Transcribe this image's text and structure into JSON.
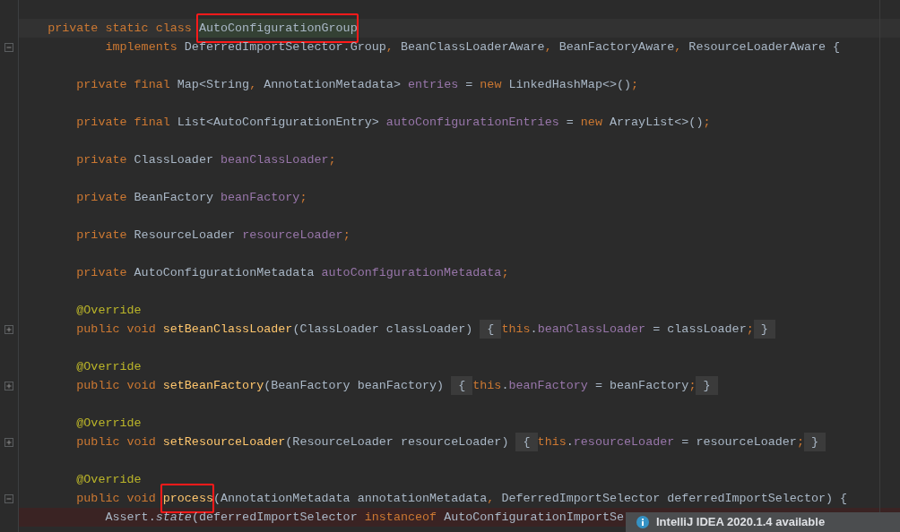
{
  "editor": {
    "lines": [
      {
        "blank_line_before": true,
        "current": true,
        "tokens": [
          {
            "text": "    private static class ",
            "kind": "keyword"
          },
          {
            "text": "AutoConfigurationGroup",
            "kind": "highlight",
            "boxed": true
          }
        ]
      },
      {
        "collapsed": false,
        "tokens": [
          {
            "text": "            implements ",
            "kind": "keyword"
          },
          {
            "text": "DeferredImportSelector.Group",
            "kind": "plain"
          },
          {
            "text": ", ",
            "kind": "keyword"
          },
          {
            "text": "BeanClassLoaderAware",
            "kind": "plain"
          },
          {
            "text": ", ",
            "kind": "keyword"
          },
          {
            "text": "BeanFactoryAware",
            "kind": "plain"
          },
          {
            "text": ", ",
            "kind": "keyword"
          },
          {
            "text": "ResourceLoaderAware {",
            "kind": "plain"
          }
        ]
      },
      {
        "blank_line_before": true,
        "tokens": [
          {
            "text": "        private final ",
            "kind": "keyword"
          },
          {
            "text": "Map<String",
            "kind": "plain"
          },
          {
            "text": ", ",
            "kind": "keyword"
          },
          {
            "text": "AnnotationMetadata> ",
            "kind": "plain"
          },
          {
            "text": "entries",
            "kind": "field"
          },
          {
            "text": " = ",
            "kind": "plain"
          },
          {
            "text": "new ",
            "kind": "keyword"
          },
          {
            "text": "LinkedHashMap<>()",
            "kind": "plain"
          },
          {
            "text": ";",
            "kind": "keyword"
          }
        ]
      },
      {
        "blank_line_before": true,
        "tokens": [
          {
            "text": "        private final ",
            "kind": "keyword"
          },
          {
            "text": "List<AutoConfigurationEntry> ",
            "kind": "plain"
          },
          {
            "text": "autoConfigurationEntries",
            "kind": "field"
          },
          {
            "text": " = ",
            "kind": "plain"
          },
          {
            "text": "new ",
            "kind": "keyword"
          },
          {
            "text": "ArrayList<>()",
            "kind": "plain"
          },
          {
            "text": ";",
            "kind": "keyword"
          }
        ]
      },
      {
        "blank_line_before": true,
        "tokens": [
          {
            "text": "        private ",
            "kind": "keyword"
          },
          {
            "text": "ClassLoader ",
            "kind": "plain"
          },
          {
            "text": "beanClassLoader",
            "kind": "field"
          },
          {
            "text": ";",
            "kind": "keyword"
          }
        ]
      },
      {
        "blank_line_before": true,
        "tokens": [
          {
            "text": "        private ",
            "kind": "keyword"
          },
          {
            "text": "BeanFactory ",
            "kind": "plain"
          },
          {
            "text": "beanFactory",
            "kind": "field"
          },
          {
            "text": ";",
            "kind": "keyword"
          }
        ]
      },
      {
        "blank_line_before": true,
        "tokens": [
          {
            "text": "        private ",
            "kind": "keyword"
          },
          {
            "text": "ResourceLoader ",
            "kind": "plain"
          },
          {
            "text": "resourceLoader",
            "kind": "field"
          },
          {
            "text": ";",
            "kind": "keyword"
          }
        ]
      },
      {
        "blank_line_before": true,
        "tokens": [
          {
            "text": "        private ",
            "kind": "keyword"
          },
          {
            "text": "AutoConfigurationMetadata ",
            "kind": "plain"
          },
          {
            "text": "autoConfigurationMetadata",
            "kind": "field"
          },
          {
            "text": ";",
            "kind": "keyword"
          }
        ]
      },
      {
        "blank_line_before": true,
        "tokens": [
          {
            "text": "        @Override",
            "kind": "annotation"
          }
        ]
      },
      {
        "collapsed": true,
        "tokens": [
          {
            "text": "        public void ",
            "kind": "keyword"
          },
          {
            "text": "setBeanClassLoader",
            "kind": "method"
          },
          {
            "text": "(ClassLoader classLoader) ",
            "kind": "plain"
          },
          {
            "text": " { ",
            "kind": "folded"
          },
          {
            "text": "this",
            "kind": "keyword"
          },
          {
            "text": ".",
            "kind": "plain"
          },
          {
            "text": "beanClassLoader",
            "kind": "field"
          },
          {
            "text": " = classLoader",
            "kind": "plain"
          },
          {
            "text": ";",
            "kind": "keyword"
          },
          {
            "text": " } ",
            "kind": "folded"
          }
        ]
      },
      {
        "blank_line_before": true,
        "tokens": [
          {
            "text": "        @Override",
            "kind": "annotation"
          }
        ]
      },
      {
        "collapsed": true,
        "tokens": [
          {
            "text": "        public void ",
            "kind": "keyword"
          },
          {
            "text": "setBeanFactory",
            "kind": "method"
          },
          {
            "text": "(BeanFactory beanFactory) ",
            "kind": "plain"
          },
          {
            "text": " { ",
            "kind": "folded"
          },
          {
            "text": "this",
            "kind": "keyword"
          },
          {
            "text": ".",
            "kind": "plain"
          },
          {
            "text": "beanFactory",
            "kind": "field"
          },
          {
            "text": " = beanFactory",
            "kind": "plain"
          },
          {
            "text": ";",
            "kind": "keyword"
          },
          {
            "text": " } ",
            "kind": "folded"
          }
        ]
      },
      {
        "blank_line_before": true,
        "tokens": [
          {
            "text": "        @Override",
            "kind": "annotation"
          }
        ]
      },
      {
        "collapsed": true,
        "tokens": [
          {
            "text": "        public void ",
            "kind": "keyword"
          },
          {
            "text": "setResourceLoader",
            "kind": "method"
          },
          {
            "text": "(ResourceLoader resourceLoader) ",
            "kind": "plain"
          },
          {
            "text": " { ",
            "kind": "folded"
          },
          {
            "text": "this",
            "kind": "keyword"
          },
          {
            "text": ".",
            "kind": "plain"
          },
          {
            "text": "resourceLoader",
            "kind": "field"
          },
          {
            "text": " = resourceLoader",
            "kind": "plain"
          },
          {
            "text": ";",
            "kind": "keyword"
          },
          {
            "text": " } ",
            "kind": "folded"
          }
        ]
      },
      {
        "blank_line_before": true,
        "tokens": [
          {
            "text": "        @Override",
            "kind": "annotation"
          }
        ]
      },
      {
        "collapsed": false,
        "tokens": [
          {
            "text": "        public void ",
            "kind": "keyword"
          },
          {
            "text": "process",
            "kind": "method",
            "boxed": true
          },
          {
            "text": "(AnnotationMetadata annotationMetadata",
            "kind": "plain"
          },
          {
            "text": ", ",
            "kind": "keyword"
          },
          {
            "text": "DeferredImportSelector deferredImportSelector) {",
            "kind": "plain"
          }
        ]
      },
      {
        "breakpoint": true,
        "tokens": [
          {
            "text": "            Assert.",
            "kind": "plain"
          },
          {
            "text": "state",
            "kind": "static"
          },
          {
            "text": "(deferredImportSelector ",
            "kind": "plain"
          },
          {
            "text": "instanceof ",
            "kind": "keyword"
          },
          {
            "text": "AutoConfigurationImportSe",
            "kind": "plain"
          }
        ]
      }
    ]
  },
  "notification": {
    "text": "IntelliJ IDEA 2020.1.4 available"
  }
}
